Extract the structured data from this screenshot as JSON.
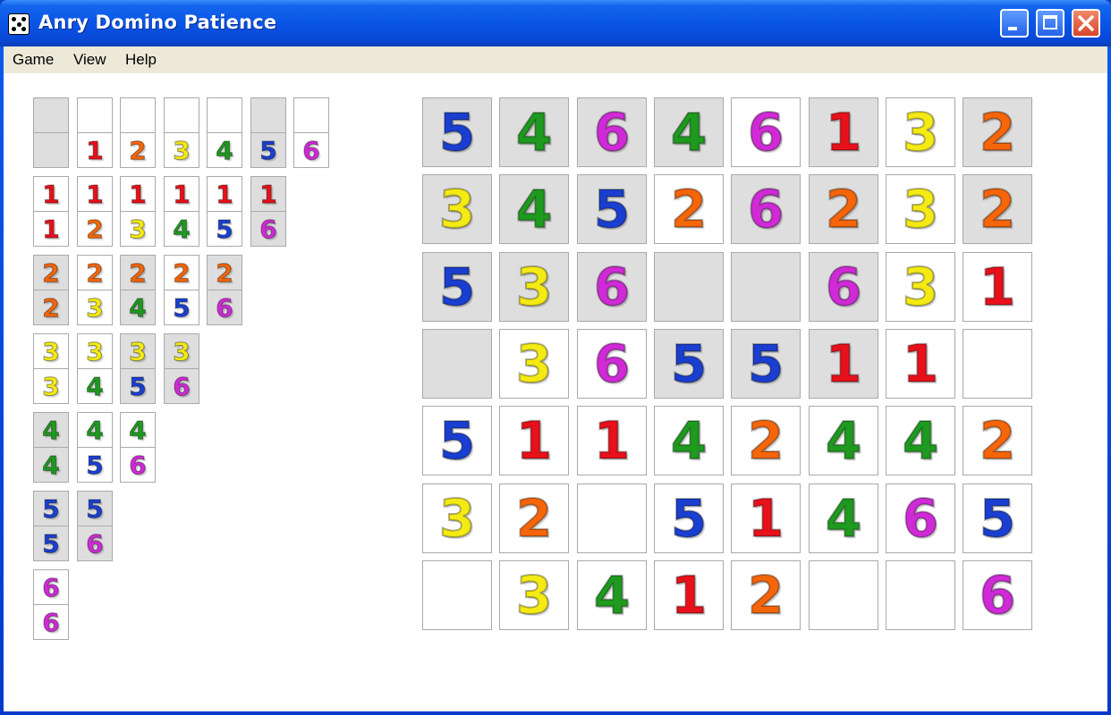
{
  "window": {
    "title": "Anry Domino Patience"
  },
  "menu": {
    "items": [
      "Game",
      "View",
      "Help"
    ]
  },
  "colors": {
    "1": "#e8101a",
    "2": "#f5650a",
    "3": "#f4ea14",
    "4": "#1e9a1e",
    "5": "#1a3fd0",
    "6": "#cf2ad6"
  },
  "reference_dominoes": [
    [
      {
        "top": "",
        "bottom": "",
        "gray": true
      },
      {
        "top": "",
        "bottom": "1",
        "gray": false
      },
      {
        "top": "",
        "bottom": "2",
        "gray": false
      },
      {
        "top": "",
        "bottom": "3",
        "gray": false
      },
      {
        "top": "",
        "bottom": "4",
        "gray": false
      },
      {
        "top": "",
        "bottom": "5",
        "gray": true
      },
      {
        "top": "",
        "bottom": "6",
        "gray": false
      }
    ],
    [
      {
        "top": "1",
        "bottom": "1",
        "gray": false
      },
      {
        "top": "1",
        "bottom": "2",
        "gray": false
      },
      {
        "top": "1",
        "bottom": "3",
        "gray": false
      },
      {
        "top": "1",
        "bottom": "4",
        "gray": false
      },
      {
        "top": "1",
        "bottom": "5",
        "gray": false
      },
      {
        "top": "1",
        "bottom": "6",
        "gray": true
      }
    ],
    [
      {
        "top": "2",
        "bottom": "2",
        "gray": true
      },
      {
        "top": "2",
        "bottom": "3",
        "gray": false
      },
      {
        "top": "2",
        "bottom": "4",
        "gray": true
      },
      {
        "top": "2",
        "bottom": "5",
        "gray": false
      },
      {
        "top": "2",
        "bottom": "6",
        "gray": true
      }
    ],
    [
      {
        "top": "3",
        "bottom": "3",
        "gray": false
      },
      {
        "top": "3",
        "bottom": "4",
        "gray": false
      },
      {
        "top": "3",
        "bottom": "5",
        "gray": true
      },
      {
        "top": "3",
        "bottom": "6",
        "gray": true
      }
    ],
    [
      {
        "top": "4",
        "bottom": "4",
        "gray": true
      },
      {
        "top": "4",
        "bottom": "5",
        "gray": false
      },
      {
        "top": "4",
        "bottom": "6",
        "gray": false
      }
    ],
    [
      {
        "top": "5",
        "bottom": "5",
        "gray": true
      },
      {
        "top": "5",
        "bottom": "6",
        "gray": true
      }
    ],
    [
      {
        "top": "6",
        "bottom": "6",
        "gray": false
      }
    ]
  ],
  "board": [
    [
      {
        "v": "5",
        "gray": true
      },
      {
        "v": "4",
        "gray": true
      },
      {
        "v": "6",
        "gray": true
      },
      {
        "v": "4",
        "gray": true
      },
      {
        "v": "6",
        "gray": false
      },
      {
        "v": "1",
        "gray": true
      },
      {
        "v": "3",
        "gray": false
      },
      {
        "v": "2",
        "gray": true
      }
    ],
    [
      {
        "v": "3",
        "gray": true
      },
      {
        "v": "4",
        "gray": true
      },
      {
        "v": "5",
        "gray": true
      },
      {
        "v": "2",
        "gray": false
      },
      {
        "v": "6",
        "gray": true
      },
      {
        "v": "2",
        "gray": true
      },
      {
        "v": "3",
        "gray": false
      },
      {
        "v": "2",
        "gray": true
      }
    ],
    [
      {
        "v": "5",
        "gray": true
      },
      {
        "v": "3",
        "gray": true
      },
      {
        "v": "6",
        "gray": true
      },
      {
        "v": "",
        "gray": true
      },
      {
        "v": "",
        "gray": true
      },
      {
        "v": "6",
        "gray": true
      },
      {
        "v": "3",
        "gray": false
      },
      {
        "v": "1",
        "gray": false
      }
    ],
    [
      {
        "v": "",
        "gray": true
      },
      {
        "v": "3",
        "gray": false
      },
      {
        "v": "6",
        "gray": false
      },
      {
        "v": "5",
        "gray": true
      },
      {
        "v": "5",
        "gray": true
      },
      {
        "v": "1",
        "gray": true
      },
      {
        "v": "1",
        "gray": false
      },
      {
        "v": "",
        "gray": false
      }
    ],
    [
      {
        "v": "5",
        "gray": false
      },
      {
        "v": "1",
        "gray": false
      },
      {
        "v": "1",
        "gray": false
      },
      {
        "v": "4",
        "gray": false
      },
      {
        "v": "2",
        "gray": false
      },
      {
        "v": "4",
        "gray": false
      },
      {
        "v": "4",
        "gray": false
      },
      {
        "v": "2",
        "gray": false
      }
    ],
    [
      {
        "v": "3",
        "gray": false
      },
      {
        "v": "2",
        "gray": false
      },
      {
        "v": "",
        "gray": false
      },
      {
        "v": "5",
        "gray": false
      },
      {
        "v": "1",
        "gray": false
      },
      {
        "v": "4",
        "gray": false
      },
      {
        "v": "6",
        "gray": false
      },
      {
        "v": "5",
        "gray": false
      }
    ],
    [
      {
        "v": "",
        "gray": false
      },
      {
        "v": "3",
        "gray": false
      },
      {
        "v": "4",
        "gray": false
      },
      {
        "v": "1",
        "gray": false
      },
      {
        "v": "2",
        "gray": false
      },
      {
        "v": "",
        "gray": false
      },
      {
        "v": "",
        "gray": false
      },
      {
        "v": "6",
        "gray": false
      }
    ]
  ]
}
